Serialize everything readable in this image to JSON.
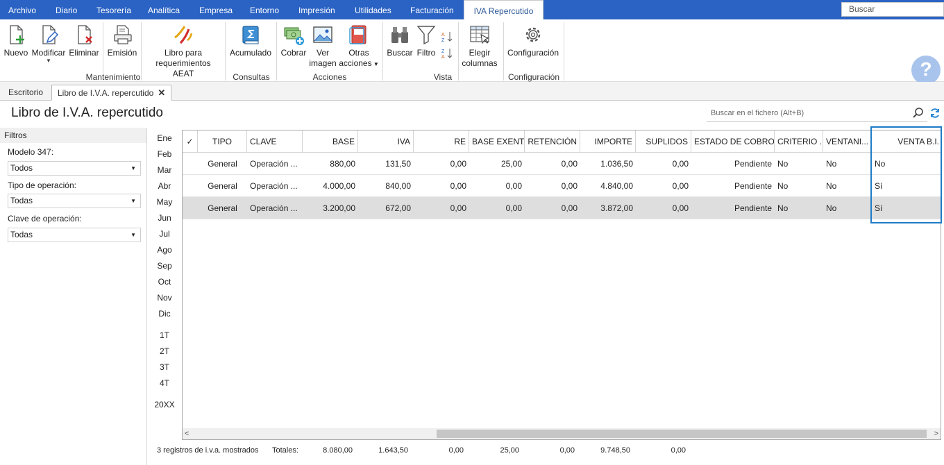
{
  "menu": {
    "items": [
      "Archivo",
      "Diario",
      "Tesorería",
      "Analítica",
      "Empresa",
      "Entorno",
      "Impresión",
      "Utilidades",
      "Facturación",
      "IVA Repercutido"
    ],
    "search_placeholder": "Buscar"
  },
  "ribbon": {
    "nuevo": "Nuevo",
    "modificar": "Modificar",
    "eliminar": "Eliminar",
    "emision": "Emisión",
    "libro_line1": "Libro para",
    "libro_line2": "requerimientos AEAT",
    "mantenimiento": "Mantenimiento",
    "acumulado": "Acumulado",
    "consultas": "Consultas",
    "cobrar": "Cobrar",
    "ver_line1": "Ver",
    "ver_line2": "imagen",
    "otras_line1": "Otras",
    "otras_line2": "acciones",
    "acciones": "Acciones",
    "buscar": "Buscar",
    "filtro": "Filtro",
    "elegir_line1": "Elegir",
    "elegir_line2": "columnas",
    "vista": "Vista",
    "configuracion": "Configuración",
    "configuracion_group": "Configuración"
  },
  "tabs": {
    "escritorio": "Escritorio",
    "libro": "Libro de I.V.A. repercutido"
  },
  "page": {
    "title": "Libro de I.V.A. repercutido",
    "search_placeholder": "Buscar en el fichero (Alt+B)"
  },
  "filters": {
    "title": "Filtros",
    "modelo_label": "Modelo 347:",
    "modelo_value": "Todos",
    "tipo_label": "Tipo de operación:",
    "tipo_value": "Todas",
    "clave_label": "Clave de operación:",
    "clave_value": "Todas"
  },
  "months": [
    "Ene",
    "Feb",
    "Mar",
    "Abr",
    "May",
    "Jun",
    "Jul",
    "Ago",
    "Sep",
    "Oct",
    "Nov",
    "Dic"
  ],
  "quarters": [
    "1T",
    "2T",
    "3T",
    "4T"
  ],
  "year": "20XX",
  "grid": {
    "headers": {
      "check": "✓",
      "tipo": "TIPO",
      "clave": "CLAVE",
      "base": "BASE",
      "iva": "IVA",
      "re": "RE",
      "base_exenta": "BASE EXENTA",
      "retencion": "RETENCIÓN",
      "importe": "IMPORTE",
      "suplidos": "SUPLIDOS",
      "estado": "ESTADO DE COBRO",
      "criterio": "CRITERIO ...",
      "ventanilla": "VENTANI...",
      "venta_bi": "VENTA B.I."
    },
    "rows": [
      {
        "tipo": "General",
        "clave": "Operación ...",
        "base": "880,00",
        "iva": "131,50",
        "re": "0,00",
        "base_exenta": "25,00",
        "retencion": "0,00",
        "importe": "1.036,50",
        "suplidos": "0,00",
        "estado": "Pendiente",
        "criterio": "No",
        "ventanilla": "No",
        "venta_bi": "No"
      },
      {
        "tipo": "General",
        "clave": "Operación ...",
        "base": "4.000,00",
        "iva": "840,00",
        "re": "0,00",
        "base_exenta": "0,00",
        "retencion": "0,00",
        "importe": "4.840,00",
        "suplidos": "0,00",
        "estado": "Pendiente",
        "criterio": "No",
        "ventanilla": "No",
        "venta_bi": "Sí"
      },
      {
        "tipo": "General",
        "clave": "Operación ...",
        "base": "3.200,00",
        "iva": "672,00",
        "re": "0,00",
        "base_exenta": "0,00",
        "retencion": "0,00",
        "importe": "3.872,00",
        "suplidos": "0,00",
        "estado": "Pendiente",
        "criterio": "No",
        "ventanilla": "No",
        "venta_bi": "Sí"
      }
    ]
  },
  "footer": {
    "count": "3 registros de i.v.a. mostrados",
    "totales_label": "Totales:",
    "base": "8.080,00",
    "iva": "1.643,50",
    "re": "0,00",
    "base_exenta": "25,00",
    "retencion": "0,00",
    "importe": "9.748,50",
    "suplidos": "0,00"
  },
  "colors": {
    "menu_bg": "#2b63c4",
    "highlight": "#1e7bc6",
    "selected_row": "#dedede"
  }
}
